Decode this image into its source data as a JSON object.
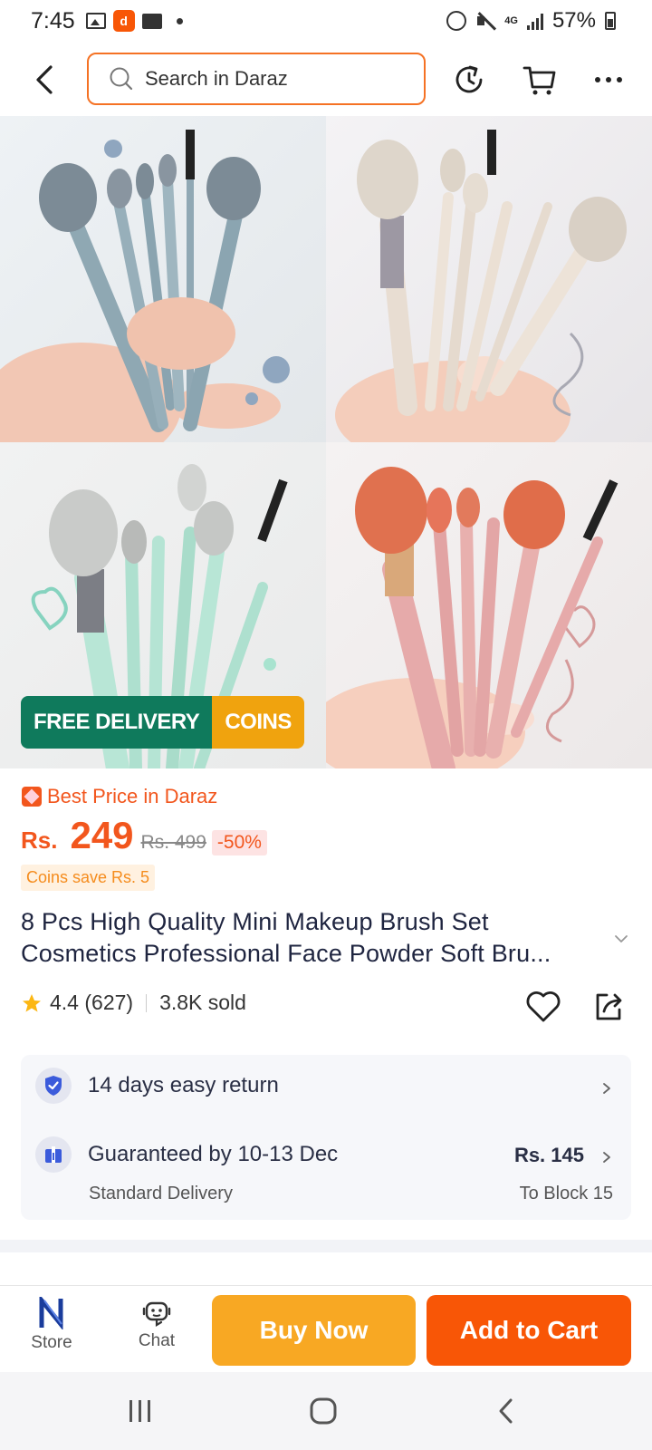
{
  "status_bar": {
    "time": "7:45",
    "network": "4G",
    "battery": "57%"
  },
  "header": {
    "search_placeholder": "Search in Daraz"
  },
  "gallery": {
    "badges": {
      "free_delivery": "FREE DELIVERY",
      "coins": "COINS"
    }
  },
  "price": {
    "best_price_label": "Best Price in Daraz",
    "currency": "Rs.",
    "current": "249",
    "original": "Rs. 499",
    "discount": "-50%",
    "coins_save": "Coins save Rs. 5"
  },
  "product": {
    "title_line1": "8 Pcs High Quality Mini Makeup Brush Set",
    "title_line2": "Cosmetics Professional Face Powder Soft Bru...",
    "rating": "4.4 (627)",
    "sold": "3.8K sold"
  },
  "info": {
    "returns": "14 days easy return",
    "delivery_guarantee": "Guaranteed by 10-13 Dec",
    "delivery_type": "Standard Delivery",
    "delivery_price": "Rs. 145",
    "delivery_location": "To Block 15"
  },
  "bottom_bar": {
    "store_label": "Store",
    "chat_label": "Chat",
    "buy_now": "Buy Now",
    "add_to_cart": "Add to Cart"
  },
  "colors": {
    "accent": "#f85606",
    "buy_now": "#f8a823",
    "free_delivery": "#0f7a5c",
    "coins": "#f0a30e",
    "price": "#f2561d"
  }
}
